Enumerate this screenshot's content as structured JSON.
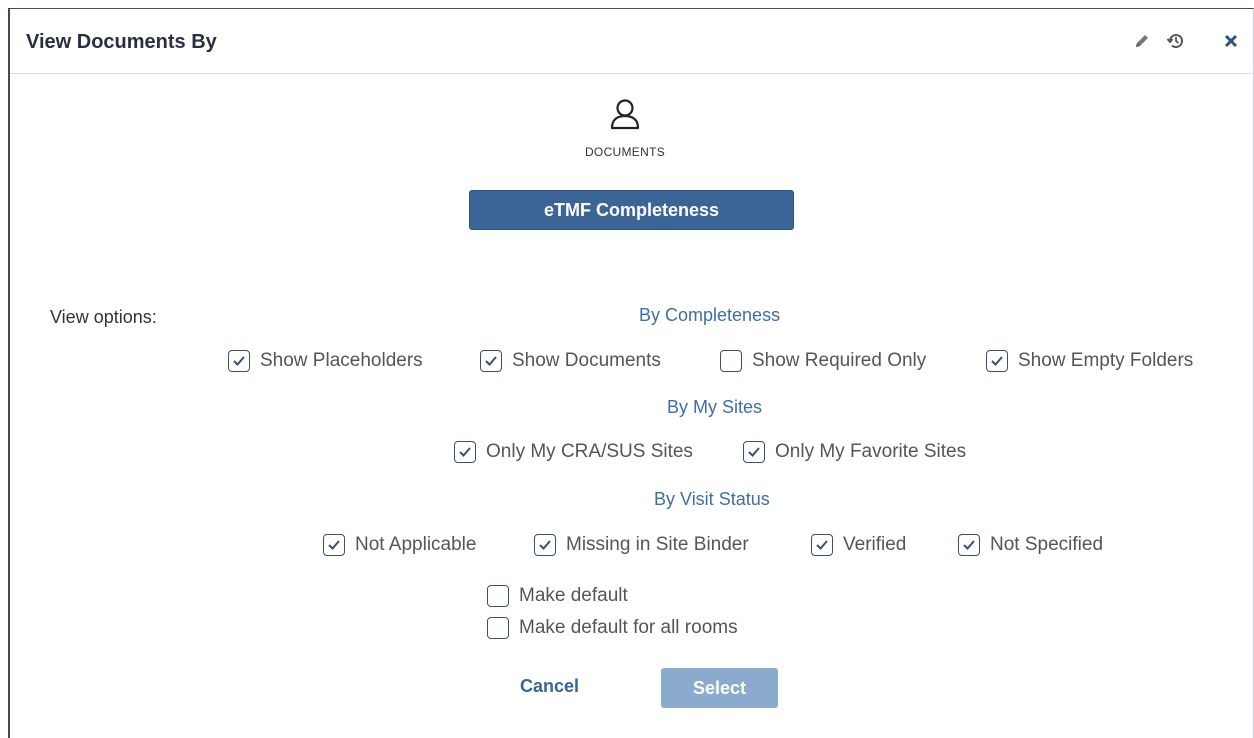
{
  "dialog": {
    "title": "View Documents By"
  },
  "header_icons": {
    "edit": "pencil-icon",
    "history": "history-icon",
    "close": "close-icon"
  },
  "view_type": {
    "icon": "user-icon",
    "label": "DOCUMENTS",
    "selector_label": "eTMF Completeness"
  },
  "view_options": {
    "label": "View options:",
    "sections": [
      {
        "title": "By Completeness",
        "options": [
          {
            "label": "Show Placeholders",
            "checked": true
          },
          {
            "label": "Show Documents",
            "checked": true
          },
          {
            "label": "Show Required Only",
            "checked": false
          },
          {
            "label": "Show Empty Folders",
            "checked": true
          }
        ]
      },
      {
        "title": "By My Sites",
        "options": [
          {
            "label": "Only My CRA/SUS Sites",
            "checked": true
          },
          {
            "label": "Only My Favorite Sites",
            "checked": true
          }
        ]
      },
      {
        "title": "By Visit Status",
        "options": [
          {
            "label": "Not Applicable",
            "checked": true
          },
          {
            "label": "Missing in Site Binder",
            "checked": true
          },
          {
            "label": "Verified",
            "checked": true
          },
          {
            "label": "Not Specified",
            "checked": true
          }
        ]
      }
    ]
  },
  "defaults": [
    {
      "label": "Make default",
      "checked": false
    },
    {
      "label": "Make default for all rooms",
      "checked": false
    }
  ],
  "actions": {
    "cancel": "Cancel",
    "select": "Select"
  },
  "colors": {
    "primary": "#3b6597",
    "link": "#3e6ea8",
    "select_disabled": "#8aabcd"
  }
}
